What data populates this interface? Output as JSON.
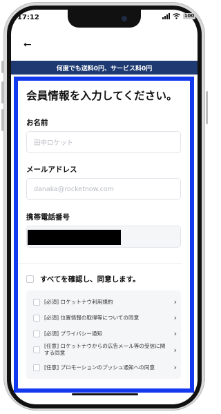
{
  "status_bar": {
    "time": "17:12",
    "battery": "100",
    "icons": [
      "signal-icon",
      "wifi-icon",
      "battery-icon"
    ]
  },
  "nav": {
    "back_icon": "back-arrow-icon",
    "back_glyph": "←"
  },
  "promo_banner": {
    "text": "何度でも送料0円、サービス料0円",
    "background": "#1f3a72"
  },
  "form": {
    "heading": "会員情報を入力してください。",
    "name": {
      "label": "お名前",
      "placeholder": "田中ロケット"
    },
    "email": {
      "label": "メールアドレス",
      "placeholder": "danaka@rocketnow.com"
    },
    "phone": {
      "label": "携帯電話番号",
      "value": ""
    }
  },
  "agreements": {
    "all_label": "すべてを確認し、同意します。",
    "items": [
      {
        "label": "[必須] ロケットナウ利用規約"
      },
      {
        "label": "[必須] 位置情報の取得等についての同意"
      },
      {
        "label": "[必須] プライバシー通知"
      },
      {
        "label": "[任意] ロケットナウからの広告メール等の受信に関する同意"
      },
      {
        "label": "[任意] プロモーションのプッシュ通知への同意"
      }
    ],
    "chevron_glyph": "›"
  },
  "colors": {
    "highlight": "#1339ee",
    "banner": "#1f3a72"
  }
}
